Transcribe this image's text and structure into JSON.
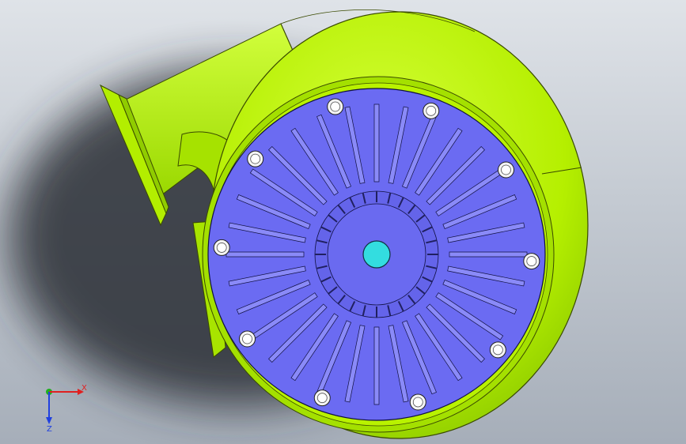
{
  "viewport": {
    "colors": {
      "housing": "#b8f000",
      "housing_outline": "#3a4a00",
      "cover": "#6b6bf2",
      "cover_outline": "#101040",
      "shaft": "#33dde0",
      "bolt": "#f4f4f4",
      "shadow": "#2a2e36"
    },
    "model": {
      "bolt_count": 10,
      "fin_count": 32
    }
  },
  "triad": {
    "x_label": "X",
    "z_label": "Z",
    "x_color": "#e02020",
    "y_color": "#20b020",
    "z_color": "#2040e0"
  }
}
